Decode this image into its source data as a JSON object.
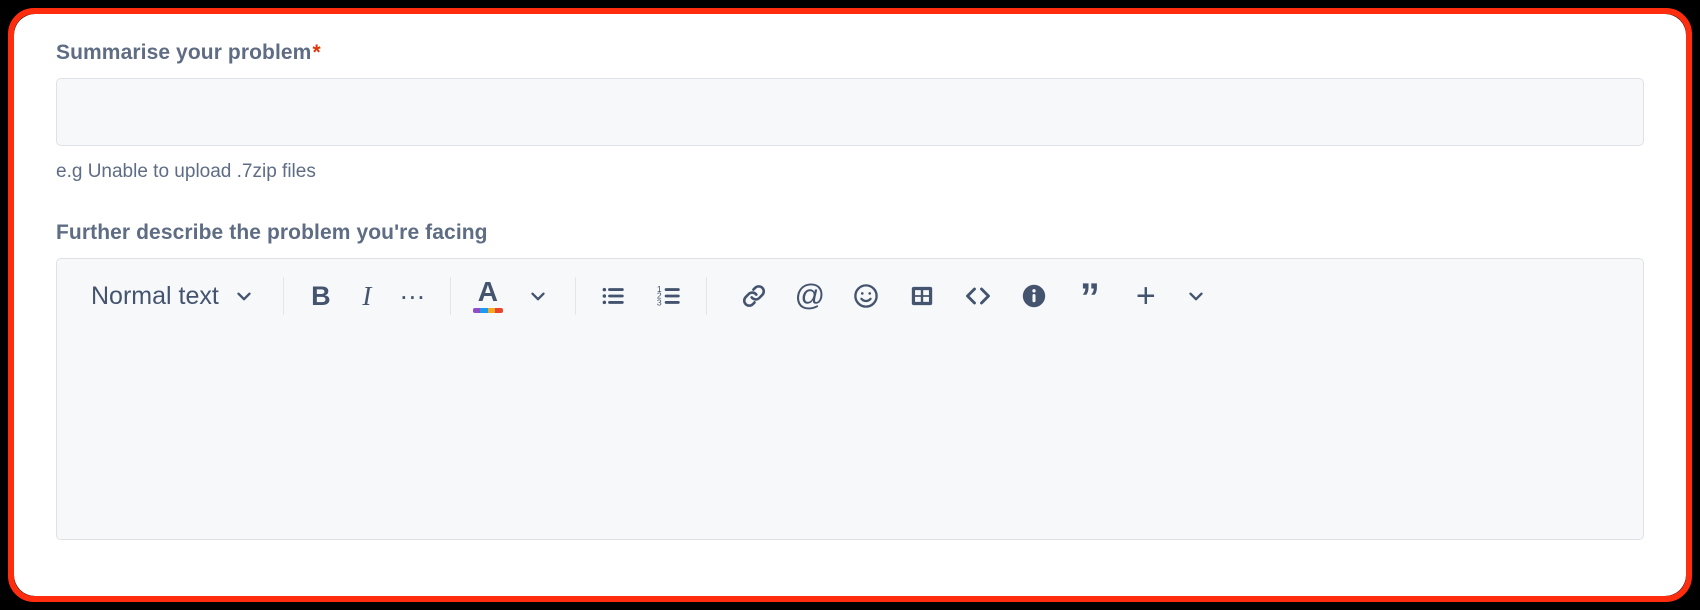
{
  "highlight": {
    "border_color": "#FF2D0E",
    "backdrop_color": "#000000"
  },
  "card": {
    "background": "#FFFFFF"
  },
  "summary_field": {
    "label": "Summarise your problem",
    "required_marker": "*",
    "required": true,
    "value": "",
    "placeholder": "",
    "helper_text": "e.g Unable to upload .7zip files",
    "label_color": "#5E6C84",
    "required_color": "#DE350B",
    "input_background": "#F7F8F9",
    "input_border": "#DFE1E6"
  },
  "description_field": {
    "label": "Further describe the problem you're facing",
    "value": "",
    "editor_background": "#F7F8F9",
    "editor_border": "#DFE1E6"
  },
  "toolbar": {
    "icon_color": "#44546F",
    "separator_color": "#E3E5E9",
    "block_type": {
      "label": "Normal text",
      "chevron": "chevron-down-icon"
    },
    "groups": [
      {
        "name": "text-format",
        "items": [
          {
            "name": "bold-button",
            "glyph": "B",
            "tooltip": "Bold"
          },
          {
            "name": "italic-button",
            "glyph": "I",
            "tooltip": "Italic"
          },
          {
            "name": "more-formatting-button",
            "glyph": "…",
            "tooltip": "More formatting"
          }
        ]
      },
      {
        "name": "text-color",
        "items": [
          {
            "name": "text-color-button",
            "glyph": "A",
            "tooltip": "Text colour",
            "swatch_colors": [
              "#8E4EC6",
              "#1D9BF0",
              "#F5A623",
              "#E8452C"
            ]
          }
        ]
      },
      {
        "name": "lists",
        "items": [
          {
            "name": "bullet-list-button",
            "tooltip": "Bulleted list"
          },
          {
            "name": "numbered-list-button",
            "tooltip": "Numbered list"
          }
        ]
      },
      {
        "name": "insert",
        "items": [
          {
            "name": "link-button",
            "tooltip": "Link"
          },
          {
            "name": "mention-button",
            "glyph": "@",
            "tooltip": "Mention"
          },
          {
            "name": "emoji-button",
            "tooltip": "Emoji"
          },
          {
            "name": "table-button",
            "tooltip": "Table"
          },
          {
            "name": "code-button",
            "tooltip": "Code snippet"
          },
          {
            "name": "info-panel-button",
            "tooltip": "Info panel"
          },
          {
            "name": "quote-button",
            "glyph": "”",
            "tooltip": "Quote"
          },
          {
            "name": "insert-more-button",
            "glyph": "+",
            "tooltip": "Insert more"
          }
        ]
      }
    ]
  }
}
